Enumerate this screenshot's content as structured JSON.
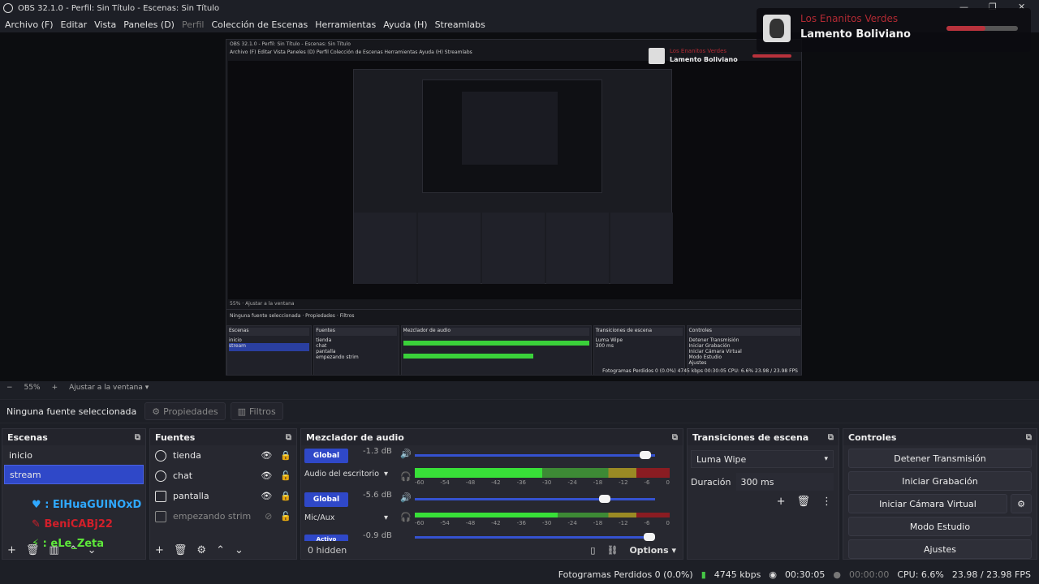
{
  "window": {
    "title": "OBS 32.1.0 - Perfil: Sin Título - Escenas: Sin Título"
  },
  "menu": [
    {
      "label": "Archivo (F)",
      "dim": false
    },
    {
      "label": "Editar",
      "dim": false
    },
    {
      "label": "Vista",
      "dim": false
    },
    {
      "label": "Paneles (D)",
      "dim": false
    },
    {
      "label": "Perfil",
      "dim": true
    },
    {
      "label": "Colección de Escenas",
      "dim": false
    },
    {
      "label": "Herramientas",
      "dim": false
    },
    {
      "label": "Ayuda (H)",
      "dim": false
    },
    {
      "label": "Streamlabs",
      "dim": false
    }
  ],
  "now_playing": {
    "artist": "Los Enanitos Verdes",
    "song": "Lamento Boliviano",
    "progress": 0.55
  },
  "zoom": {
    "minus": "−",
    "value": "55%",
    "plus": "+",
    "fit": "Ajustar a la ventana"
  },
  "source_bar": {
    "none_selected": "Ninguna fuente seleccionada",
    "properties": "Propiedades",
    "filters": "Filtros"
  },
  "nested": {
    "statusbar": "Fotogramas Perdidos 0 (0.0%)   4745 kbps   00:30:05   CPU: 6.6%   23.98 / 23.98 FPS"
  },
  "scenes": {
    "title": "Escenas",
    "items": [
      {
        "label": "inicio",
        "selected": false
      },
      {
        "label": "stream",
        "selected": true
      }
    ]
  },
  "chat_overlay": [
    {
      "name": ": ElHuaGUINOxD",
      "color": "#2fa8ff",
      "icon": "♥"
    },
    {
      "name": "BeniCABj22",
      "color": "#d21f2a",
      "icon": "✎"
    },
    {
      "name": ": eLe_Zeta",
      "color": "#5ee83a",
      "icon": "⚡"
    }
  ],
  "sources": {
    "title": "Fuentes",
    "items": [
      {
        "label": "tienda",
        "type": "browser",
        "visible": true,
        "locked": true
      },
      {
        "label": "chat",
        "type": "browser",
        "visible": true,
        "locked": false
      },
      {
        "label": "pantalla",
        "type": "monitor",
        "visible": true,
        "locked": true
      },
      {
        "label": "empezando strim",
        "type": "image",
        "visible": false,
        "locked": false
      }
    ]
  },
  "mixer": {
    "title": "Mezclador de audio",
    "channels": [
      {
        "badge": "Global",
        "db": "-1.3 dB",
        "name": "Audio del escritorio",
        "volume": 0.96
      },
      {
        "badge": "Global",
        "db": "-5.6 dB",
        "name": "Mic/Aux",
        "volume": 0.79
      },
      {
        "badge": "Activo",
        "db": "-0.9 dB",
        "name": "",
        "volume": 0.98
      }
    ],
    "ticks": [
      "-60",
      "-54",
      "-48",
      "-42",
      "-36",
      "-30",
      "-24",
      "-18",
      "-12",
      "-6",
      "0"
    ],
    "hidden": "0 hidden",
    "options": "Options"
  },
  "transitions": {
    "title": "Transiciones de escena",
    "selected": "Luma Wipe",
    "duration_label": "Duración",
    "duration": "300 ms"
  },
  "controls": {
    "title": "Controles",
    "buttons": [
      "Detener Transmisión",
      "Iniciar Grabación",
      "Iniciar Cámara Virtual",
      "Modo Estudio",
      "Ajustes"
    ]
  },
  "status": {
    "dropped": "Fotogramas Perdidos 0 (0.0%)",
    "bitrate": "4745 kbps",
    "stream_time": "00:30:05",
    "record_time": "00:00:00",
    "cpu": "CPU: 6.6%",
    "fps": "23.98 / 23.98 FPS"
  },
  "colors": {
    "accent": "#2f48c8",
    "background": "#1d1f26",
    "dock": "#272830",
    "song_red": "#b12a33"
  }
}
